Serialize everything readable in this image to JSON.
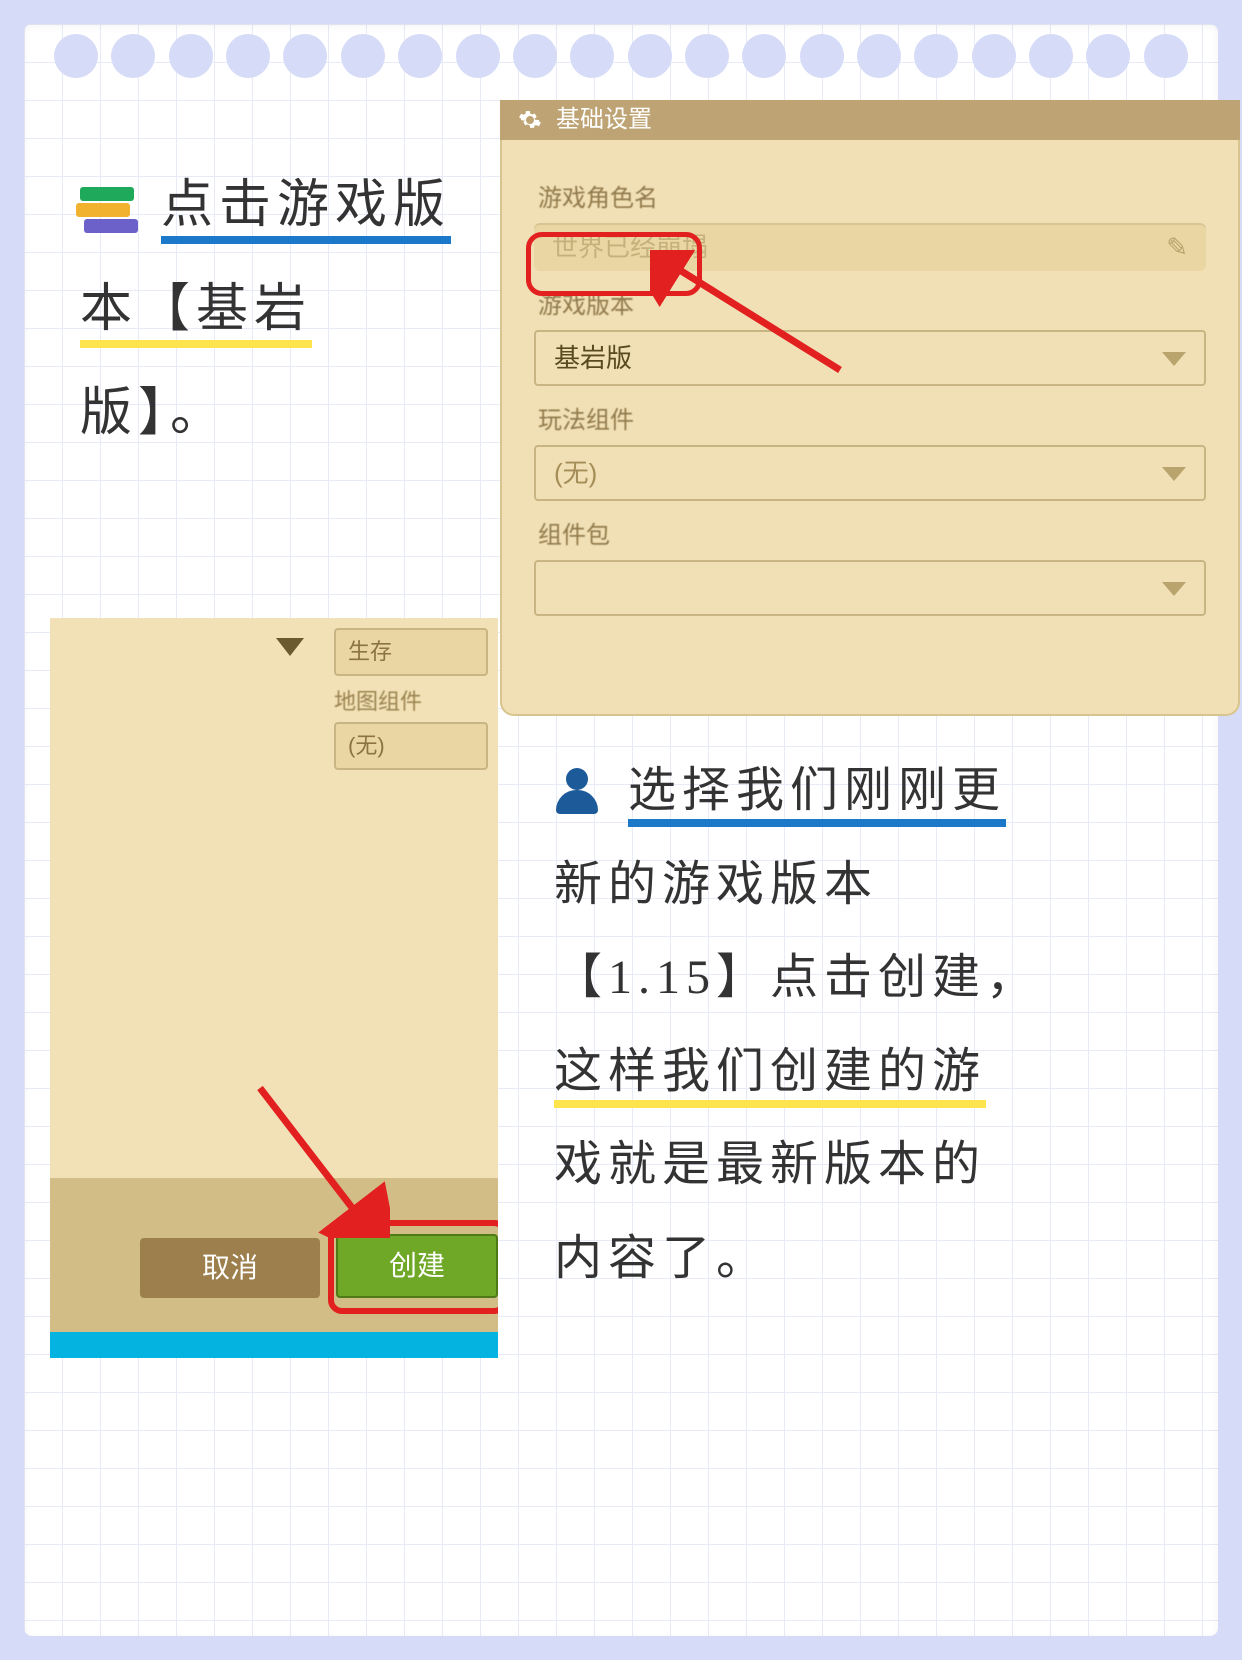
{
  "note_top": {
    "line1": "点击游戏版",
    "line2_a": "本【基岩",
    "line3": "版】。"
  },
  "note_bottom": {
    "line1": "选择我们刚刚更",
    "line2": "新的游戏版本",
    "line3": "【1.15】点击创建，",
    "line4": "这样我们创建的游",
    "line5": "戏就是最新版本的",
    "line6": "内容了。"
  },
  "settings_panel": {
    "title": "基础设置",
    "character_label": "游戏角色名",
    "character_value": "世界已经崩塌",
    "version_label": "游戏版本",
    "version_value": "基岩版",
    "module_label": "玩法组件",
    "module_value": "(无)",
    "pack_label": "组件包",
    "pack_value": ""
  },
  "create_panel": {
    "mode_value": "生存",
    "map_label": "地图组件",
    "map_value": "(无)",
    "cancel": "取消",
    "create": "创建"
  }
}
